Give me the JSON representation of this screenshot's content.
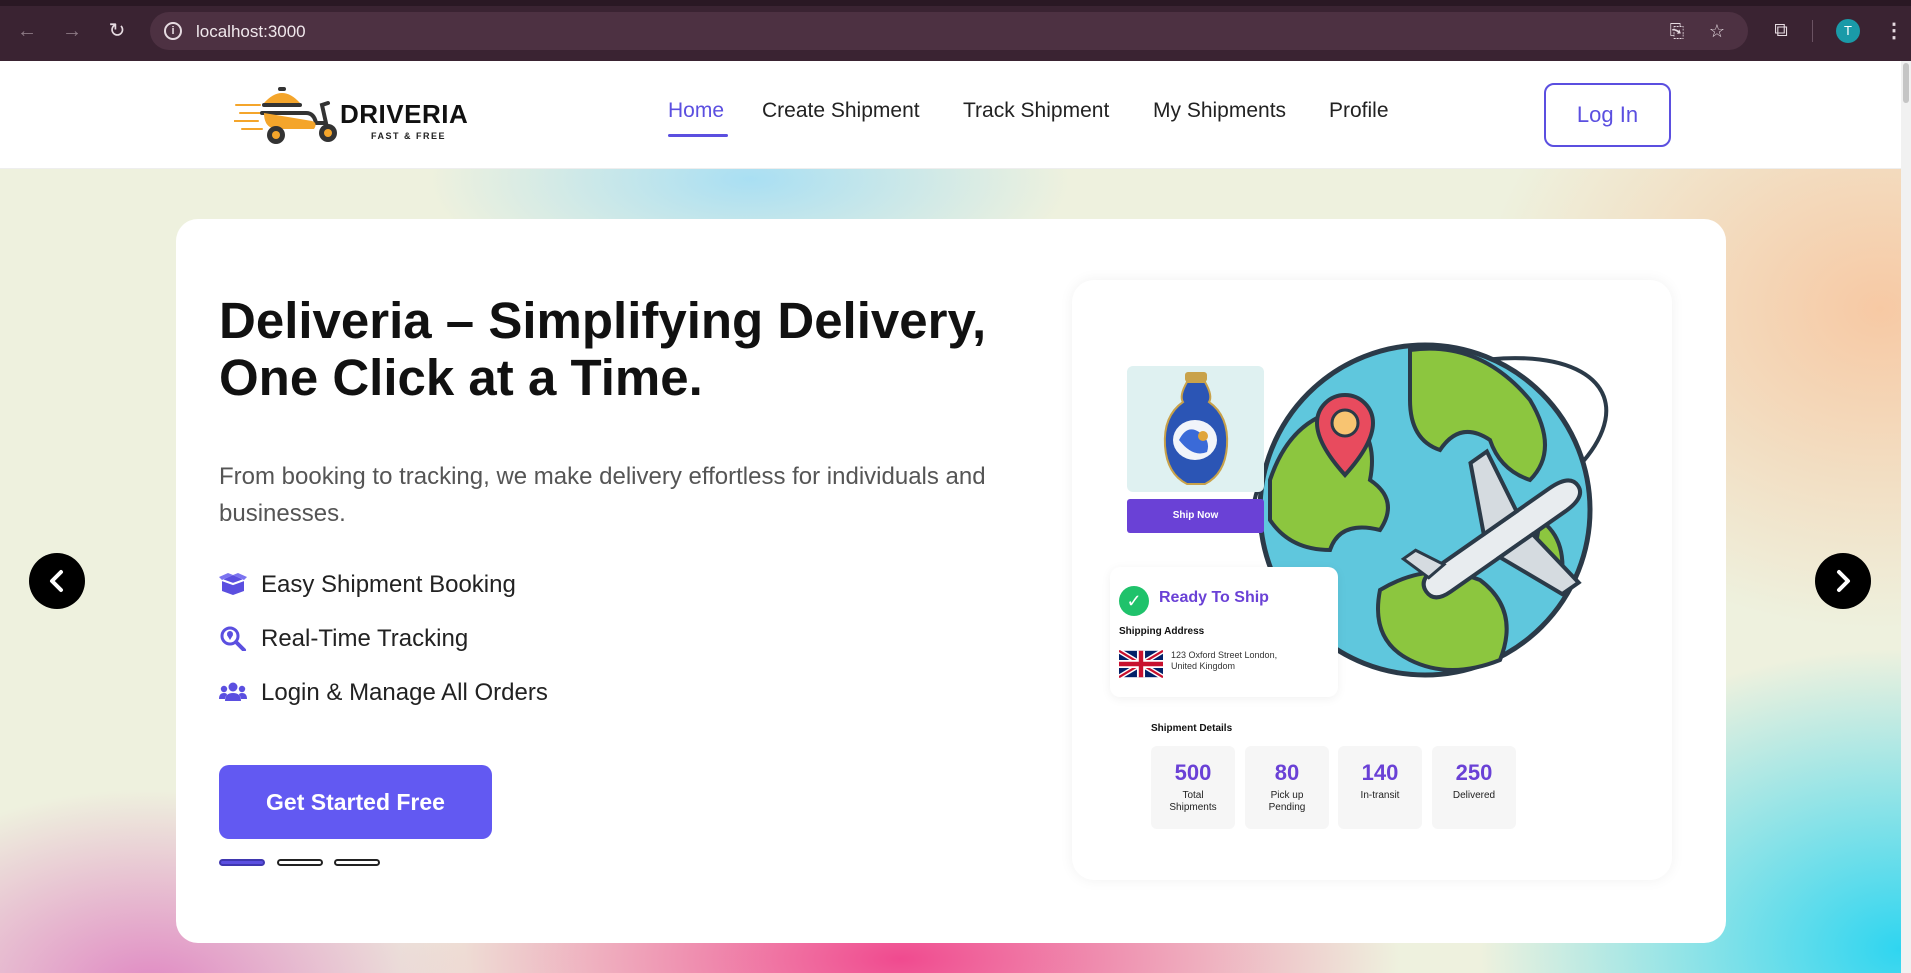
{
  "browser": {
    "url": "localhost:3000",
    "avatar_initial": "T"
  },
  "site": {
    "logo_name": "DRIVERIA",
    "logo_tagline": "FAST & FREE",
    "nav": {
      "home": "Home",
      "create": "Create Shipment",
      "track": "Track Shipment",
      "mine": "My Shipments",
      "profile": "Profile"
    },
    "login_label": "Log In",
    "accent_color": "#5b4fe0"
  },
  "hero": {
    "title": "Deliveria – Simplifying Delivery, One Click at a Time.",
    "subtitle": "From booking to tracking, we make delivery effortless for individuals and businesses.",
    "features": [
      {
        "icon": "box-open-icon",
        "label": "Easy Shipment Booking"
      },
      {
        "icon": "search-location-icon",
        "label": "Real-Time Tracking"
      },
      {
        "icon": "users-icon",
        "label": "Login & Manage All Orders"
      }
    ],
    "cta_label": "Get Started Free",
    "slides_total": 3,
    "slide_active": 1
  },
  "illustration": {
    "ship_now": "Ship Now",
    "ready": "Ready To Ship",
    "shipping_address_label": "Shipping Address",
    "address": "123 Oxford Street London, United Kingdom",
    "details_title": "Shipment Details",
    "stats": [
      {
        "value": "500",
        "label": "Total Shipments"
      },
      {
        "value": "80",
        "label": "Pick up Pending"
      },
      {
        "value": "140",
        "label": "In-transit"
      },
      {
        "value": "250",
        "label": "Delivered"
      }
    ]
  }
}
